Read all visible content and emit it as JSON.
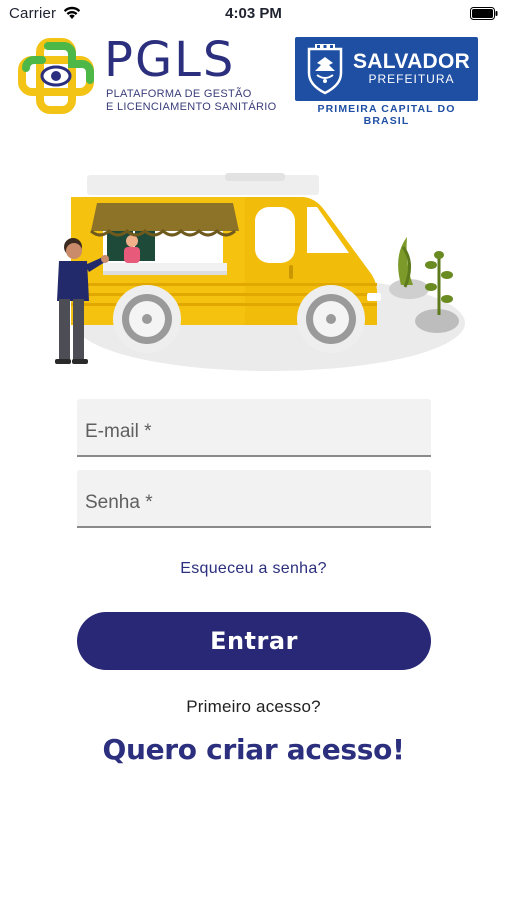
{
  "status_bar": {
    "carrier": "Carrier",
    "time": "4:03 PM",
    "icons": [
      "wifi-icon",
      "battery-icon"
    ]
  },
  "header": {
    "pgls_logo": {
      "name": "PGLS",
      "subtitle_line1": "PLATAFORMA DE GESTÃO",
      "subtitle_line2": "E LICENCIAMENTO SANITÁRIO"
    },
    "salvador_logo": {
      "city": "SALVADOR",
      "prefeitura": "PREFEITURA",
      "tagline": "PRIMEIRA CAPITAL DO BRASIL"
    }
  },
  "illustration": {
    "icon": "food-truck-illustration"
  },
  "form": {
    "email": {
      "placeholder": "E-mail *",
      "value": ""
    },
    "password": {
      "placeholder": "Senha *",
      "value": ""
    },
    "forgot_label": "Esqueceu a senha?",
    "submit_label": "Entrar"
  },
  "footer": {
    "first_access_label": "Primeiro acesso?",
    "create_access_label": "Quero criar acesso!"
  },
  "colors": {
    "brand_navy": "#282876",
    "salvador_blue": "#1f4fa3",
    "truck_yellow": "#f5c30f",
    "logo_green": "#4db848",
    "logo_yellow": "#f3c316",
    "field_bg": "#f2f2f2"
  }
}
